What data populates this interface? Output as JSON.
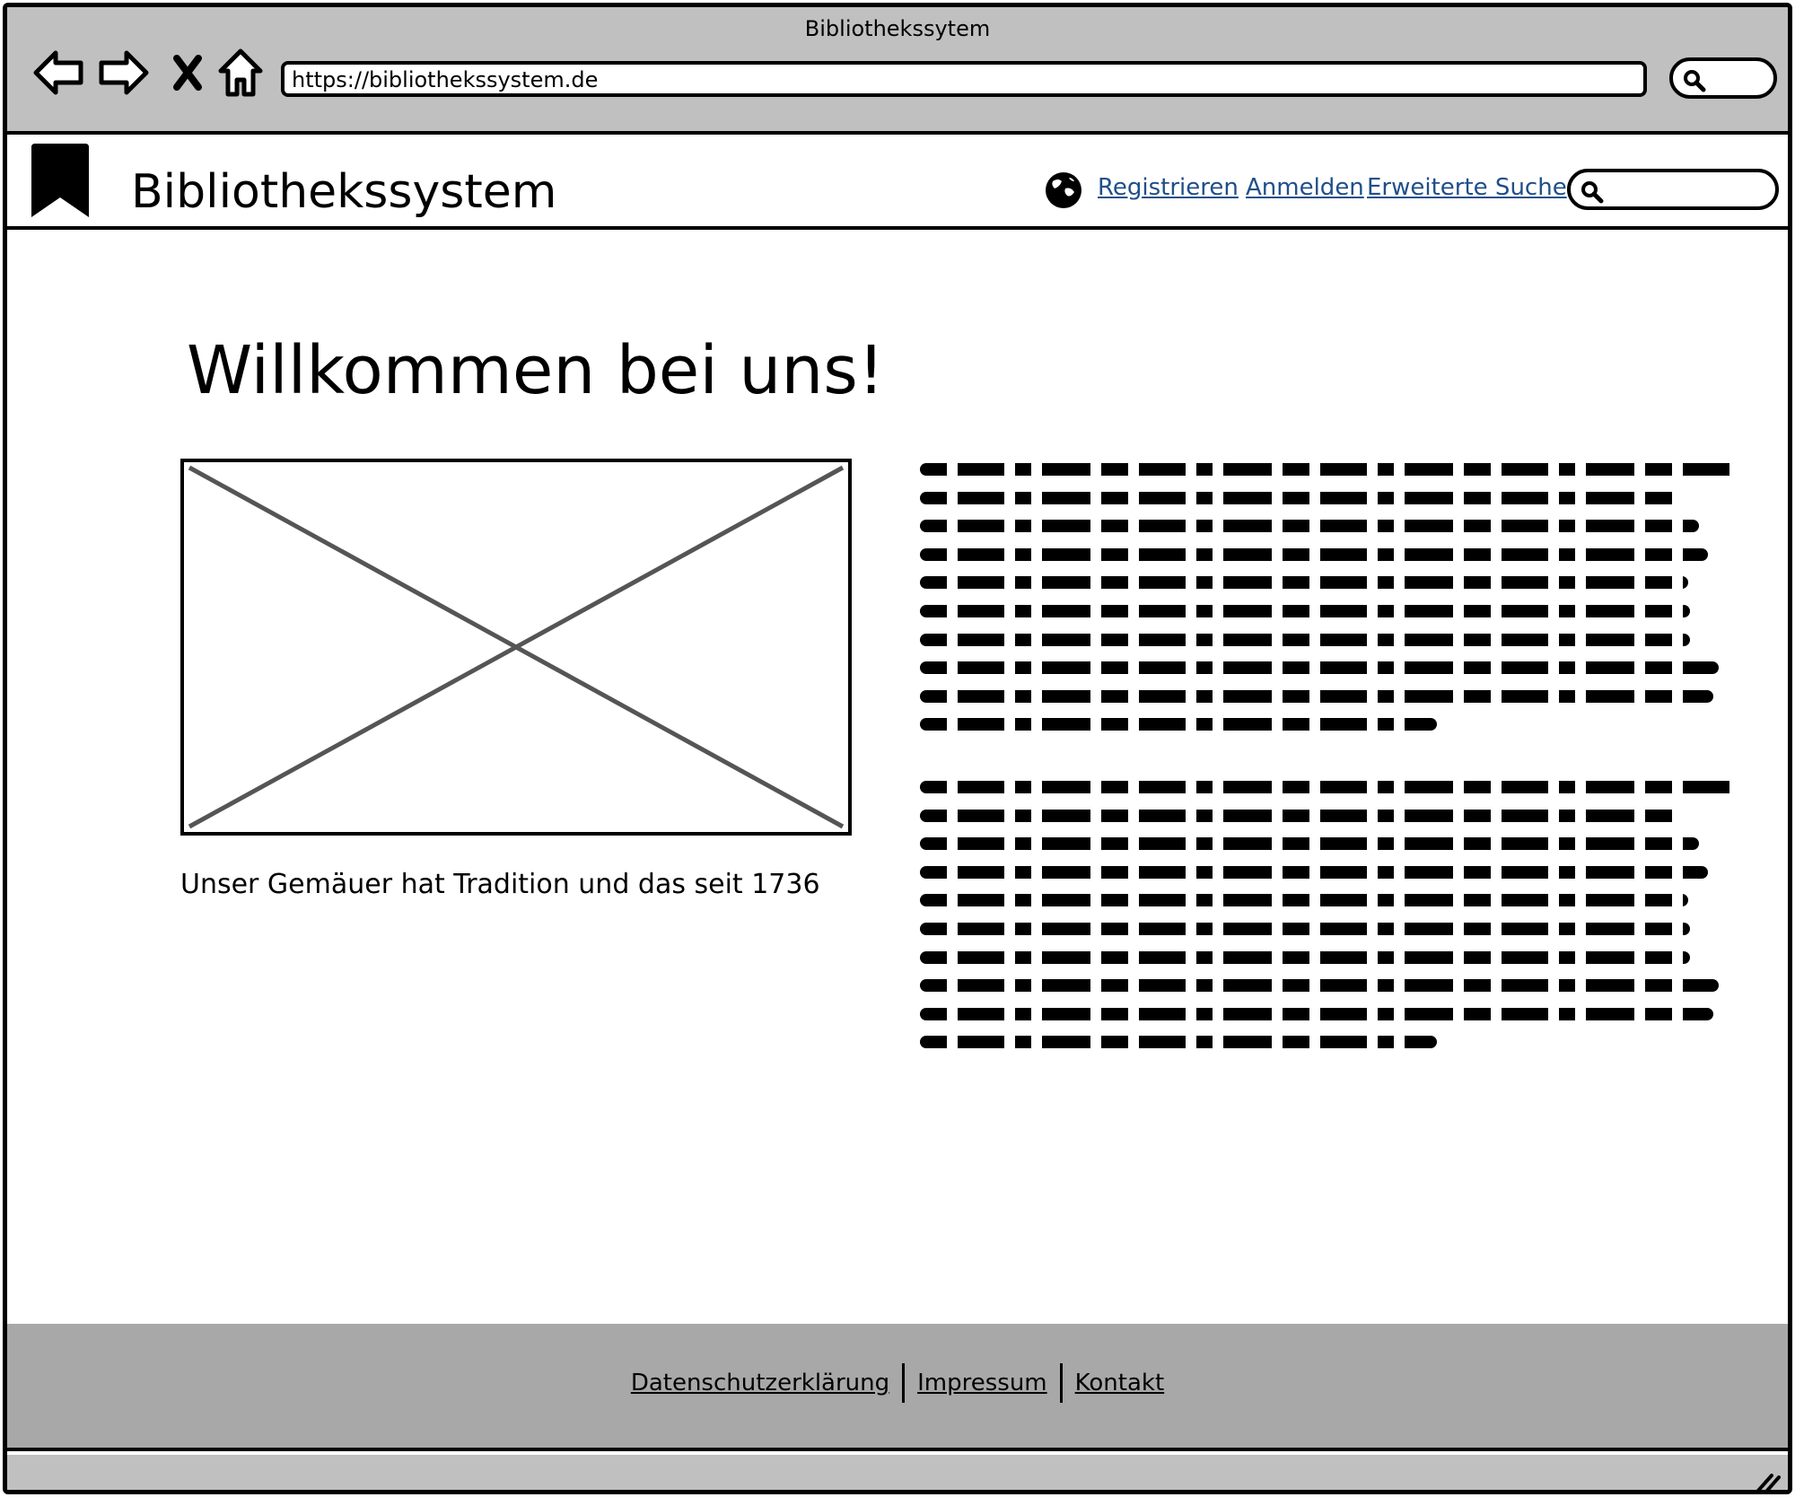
{
  "browser": {
    "window_title": "Bibliothekssytem",
    "url": "https://bibliothekssystem.de",
    "icons": [
      "back-arrow-icon",
      "forward-arrow-icon",
      "close-x-icon",
      "home-icon",
      "search-icon"
    ]
  },
  "header": {
    "site_title": "Bibliothekssystem",
    "logo_icon": "bookmark-icon",
    "language_icon": "globe-icon",
    "nav": [
      {
        "label": "Registrieren"
      },
      {
        "label": "Anmelden"
      },
      {
        "label": "Erweiterte Suche"
      }
    ],
    "search_placeholder": ""
  },
  "main": {
    "title": "Willkommen bei uns!",
    "image_caption": "Unser Gemäuer hat Tradition und das seit 1736"
  },
  "footer": {
    "links": [
      {
        "label": "Datenschutzerklärung"
      },
      {
        "label": "Impressum"
      },
      {
        "label": "Kontakt"
      }
    ]
  },
  "colors": {
    "chrome_bg": "#c0c0c0",
    "footer_bg": "#a8a8a8",
    "link": "#1f4f8a"
  }
}
